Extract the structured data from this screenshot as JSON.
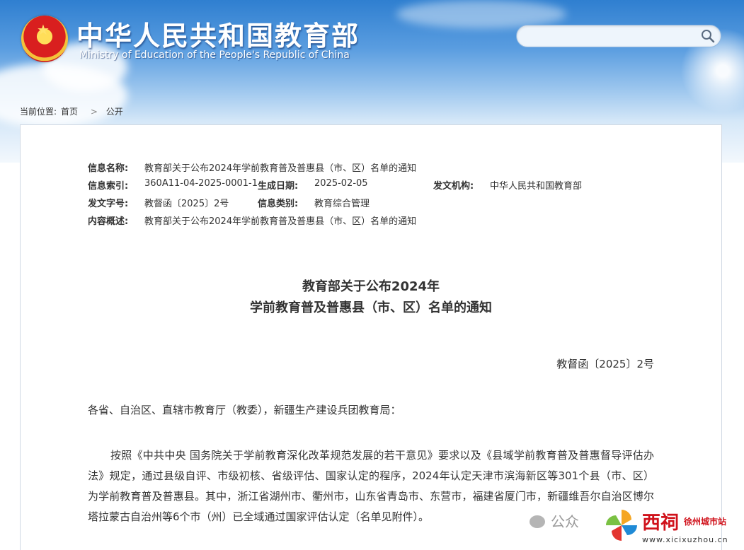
{
  "header": {
    "title": "中华人民共和国教育部",
    "subtitle": "Ministry of Education of the People's Republic of China",
    "search": {
      "placeholder": ""
    }
  },
  "breadcrumb": {
    "prefix": "当前位置:",
    "home": "首页",
    "separator": ">",
    "current": "公开"
  },
  "metadata": {
    "name_label": "信息名称:",
    "name_value": "教育部关于公布2024年学前教育普及普惠县（市、区）名单的通知",
    "index_label": "信息索引:",
    "index_value": "360A11-04-2025-0001-1",
    "date_label": "生成日期:",
    "date_value": "2025-02-05",
    "agency_label": "发文机构:",
    "agency_value": "中华人民共和国教育部",
    "docno_label": "发文字号:",
    "docno_value": "教督函〔2025〕2号",
    "category_label": "信息类别:",
    "category_value": "教育综合管理",
    "summary_label": "内容概述:",
    "summary_value": "教育部关于公布2024年学前教育普及普惠县（市、区）名单的通知"
  },
  "document": {
    "title_line1": "教育部关于公布2024年",
    "title_line2": "学前教育普及普惠县（市、区）名单的通知",
    "number": "教督函〔2025〕2号",
    "addressee": "各省、自治区、直辖市教育厅（教委），新疆生产建设兵团教育局：",
    "paragraph1": "按照《中共中央 国务院关于学前教育深化改革规范发展的若干意见》要求以及《县域学前教育普及普惠督导评估办法》规定，通过县级自评、市级初核、省级评估、国家认定的程序，2024年认定天津市滨海新区等301个县（市、区）为学前教育普及普惠县。其中，浙江省湖州市、衢州市，山东省青岛市、东营市，福建省厦门市，新疆维吾尔自治区博尔塔拉蒙古自治州等6个市（州）已全域通过国家评估认定（名单见附件）。"
  },
  "watermark": {
    "wechat_label": "公众",
    "brand_name": "西祠",
    "brand_city": "徐州城市站",
    "brand_url": "www.xicixuzhou.cn"
  },
  "colors": {
    "banner_top": "#2f7fd0",
    "brand_red": "#d0121b",
    "text": "#333333"
  }
}
